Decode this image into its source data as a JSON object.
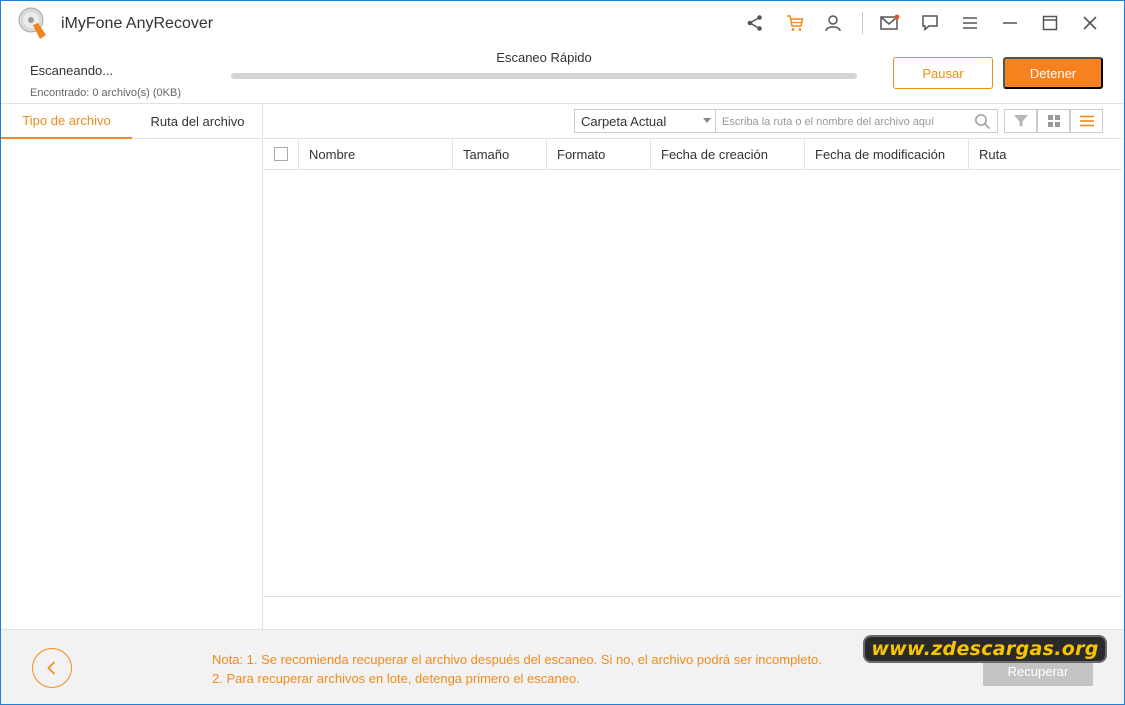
{
  "app": {
    "title": "iMyFone AnyRecover"
  },
  "titlebar_icons": [
    "share-icon",
    "cart-icon",
    "user-icon",
    "mail-icon",
    "chat-icon",
    "menu-icon",
    "minimize-icon",
    "maximize-icon",
    "close-icon"
  ],
  "scan": {
    "status": "Escaneando...",
    "found": "Encontrado: 0 archivo(s) (0KB)",
    "mode": "Escaneo Rápido",
    "progress": 0
  },
  "buttons": {
    "pause": "Pausar",
    "stop": "Detener",
    "recover": "Recuperar"
  },
  "tabs": [
    {
      "label": "Tipo de archivo",
      "active": true
    },
    {
      "label": "Ruta del archivo",
      "active": false
    }
  ],
  "toolbar": {
    "folder_select": "Carpeta Actual",
    "search_placeholder": "Escriba la ruta o el nombre del archivo aquí"
  },
  "table": {
    "columns": [
      "Nombre",
      "Tamaño",
      "Formato",
      "Fecha de creación",
      "Fecha de modificación",
      "Ruta"
    ],
    "rows": []
  },
  "footer": {
    "note_line1": "Nota: 1. Se recomienda recuperar el archivo después del escaneo. Si no, el archivo podrá ser incompleto.",
    "note_line2": "2. Para recuperar archivos en lote, detenga primero el escaneo."
  },
  "watermark": "www.zdescargas.org",
  "colors": {
    "accent": "#f08c1c",
    "accent_fill": "#f5821f",
    "disabled": "#c4c4c4"
  }
}
